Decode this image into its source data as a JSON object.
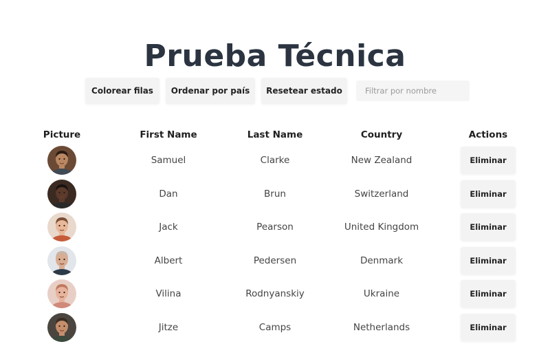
{
  "page": {
    "title": "Prueba Técnica"
  },
  "toolbar": {
    "color_rows_label": "Colorear filas",
    "sort_by_country_label": "Ordenar por país",
    "reset_state_label": "Resetear estado",
    "filter_placeholder": "Filtrar por nombre",
    "filter_value": ""
  },
  "table": {
    "headers": {
      "picture": "Picture",
      "first_name": "First Name",
      "last_name": "Last Name",
      "country": "Country",
      "actions": "Actions"
    },
    "rows": [
      {
        "first": "Samuel",
        "last": "Clarke",
        "country": "New Zealand",
        "action": "Eliminar",
        "avatar": {
          "bg": "#6b4a35",
          "skin": "#b98762",
          "hair": "#2a1c14",
          "shirt": "#3f4a55"
        }
      },
      {
        "first": "Dan",
        "last": "Brun",
        "country": "Switzerland",
        "action": "Eliminar",
        "avatar": {
          "bg": "#3a2a22",
          "skin": "#5a3a2b",
          "hair": "#1a1210",
          "shirt": "#2a2a2a"
        }
      },
      {
        "first": "Jack",
        "last": "Pearson",
        "country": "United Kingdom",
        "action": "Eliminar",
        "avatar": {
          "bg": "#e9d8cc",
          "skin": "#e8b89a",
          "hair": "#7a4e34",
          "shirt": "#c65b3a"
        }
      },
      {
        "first": "Albert",
        "last": "Pedersen",
        "country": "Denmark",
        "action": "Eliminar",
        "avatar": {
          "bg": "#e2e6ea",
          "skin": "#d9ad92",
          "hair": "#c9b4a5",
          "shirt": "#2d3a48"
        }
      },
      {
        "first": "Vilina",
        "last": "Rodnyanskiy",
        "country": "Ukraine",
        "action": "Eliminar",
        "avatar": {
          "bg": "#e8cfc6",
          "skin": "#e7b39c",
          "hair": "#c07a5f",
          "shirt": "#d08a7a"
        }
      },
      {
        "first": "Jitze",
        "last": "Camps",
        "country": "Netherlands",
        "action": "Eliminar",
        "avatar": {
          "bg": "#4b4540",
          "skin": "#c48e6c",
          "hair": "#3a2c22",
          "shirt": "#3c4a3e"
        }
      }
    ]
  }
}
